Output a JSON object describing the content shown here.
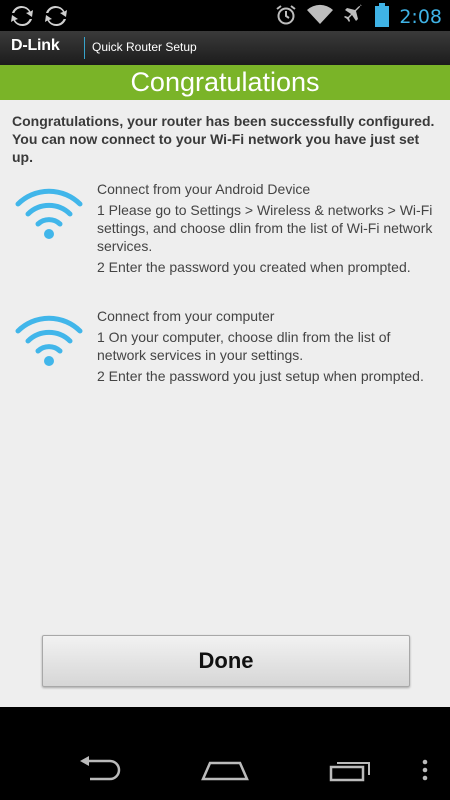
{
  "status_bar": {
    "time": "2:08",
    "icons": [
      "sync-icon",
      "sync-icon",
      "alarm-icon",
      "wifi-signal-icon",
      "airplane-icon",
      "battery-icon"
    ]
  },
  "header": {
    "brand": "D-Link",
    "subtitle": "Quick Router Setup"
  },
  "title": "Congratulations",
  "intro": "Congratulations, your router has been successfully configured. You can now connect to your Wi-Fi network you have just set up.",
  "sections": [
    {
      "icon": "wifi-icon",
      "title": "Connect from your Android Device",
      "step1": "1 Please go to Settings > Wireless & networks > Wi-Fi settings, and choose dlin from the list of Wi-Fi network services.",
      "step2": "2 Enter the password you created when prompted."
    },
    {
      "icon": "wifi-icon",
      "title": "Connect from your computer",
      "step1": "1 On your computer, choose dlin from the list of network services in your settings.",
      "step2": "2 Enter the password you just setup when prompted."
    }
  ],
  "done_label": "Done",
  "colors": {
    "accent_green": "#7ab428",
    "wifi_blue": "#41b6ea",
    "clock_blue": "#3fb3e6"
  },
  "nav": [
    "back-icon",
    "home-icon",
    "recents-icon",
    "overflow-menu-icon"
  ]
}
